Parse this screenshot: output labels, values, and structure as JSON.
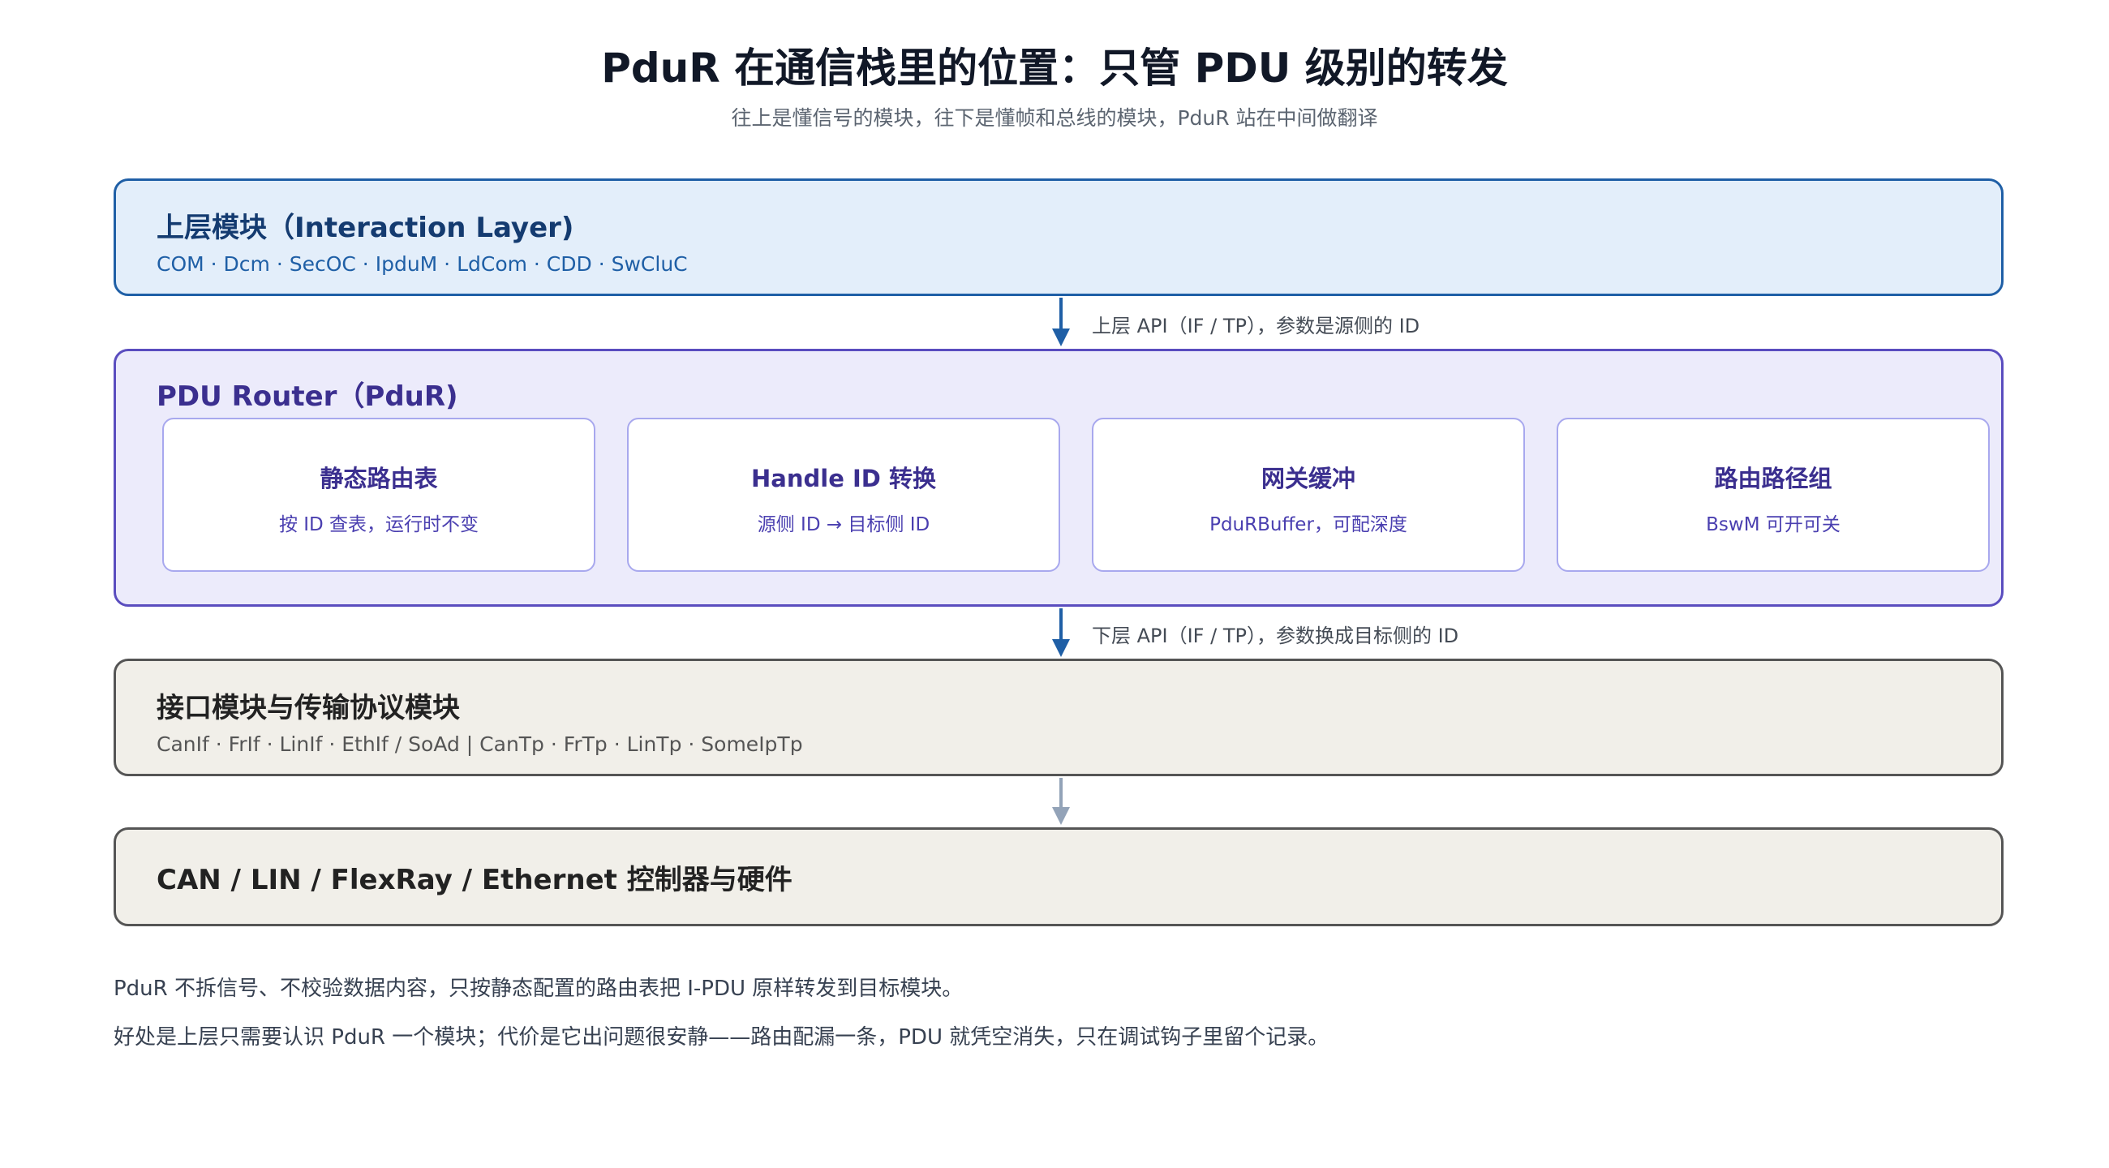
{
  "title": "PduR 在通信栈里的位置：只管 PDU 级别的转发",
  "subtitle": "往上是懂信号的模块，往下是懂帧和总线的模块，PduR 站在中间做翻译",
  "upper_layer": {
    "heading": "上层模块（Interaction Layer)",
    "modules": "COM · Dcm · SecOC · IpduM · LdCom · CDD · SwCluC"
  },
  "arrow_down_1": "上层 API（IF / TP），参数是源侧的 ID",
  "pdur_layer": {
    "heading": "PDU Router（PduR)",
    "cards": [
      {
        "title": "静态路由表",
        "desc": "按 ID 查表，运行时不变"
      },
      {
        "title": "Handle ID 转换",
        "desc": "源侧 ID → 目标侧 ID"
      },
      {
        "title": "网关缓冲",
        "desc": "PduRBuffer，可配深度"
      },
      {
        "title": "路由路径组",
        "desc": "BswM 可开可关"
      }
    ]
  },
  "arrow_down_2": "下层 API（IF / TP），参数换成目标侧的 ID",
  "interface_layer": {
    "heading": "接口模块与传输协议模块",
    "modules": "CanIf · FrIf · LinIf · EthIf / SoAd  |  CanTp · FrTp · LinTp · SomeIpTp"
  },
  "hardware_layer": {
    "heading": "CAN / LIN / FlexRay / Ethernet 控制器与硬件"
  },
  "notes": [
    "PduR 不拆信号、不校验数据内容，只按静态配置的路由表把 I-PDU 原样转发到目标模块。",
    "好处是上层只需要认识 PduR 一个模块；代价是它出问题很安静——路由配漏一条，PDU 就凭空消失，只在调试钩子里留个记录。"
  ],
  "colors": {
    "upper_border": "#1f5fa6",
    "upper_fill": "#e3eefa",
    "pdur_border": "#5a4dbf",
    "pdur_fill": "#ecebfb",
    "lower_border": "#555555",
    "lower_fill": "#f1efe9",
    "arrow_primary": "#1f5fa6",
    "arrow_muted": "#93a3b8"
  }
}
